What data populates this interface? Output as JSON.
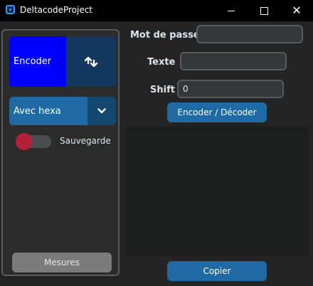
{
  "window": {
    "title": "DeltacodeProject",
    "minimize_icon": "minimize-icon",
    "maximize_icon": "maximize-icon",
    "close_glyph": "✕"
  },
  "sidebar": {
    "mode_label": "Encoder",
    "mode_icon": "swap-arrows-icon",
    "hexa_option": "Avec hexa",
    "dropdown_icon": "chevron-down-icon",
    "switch_label": "Sauvegarde",
    "switch_on": false,
    "mesures_button": "Mesures"
  },
  "form": {
    "password_label": "Mot de passe",
    "password_value": "",
    "text_label": "Texte",
    "text_value": "",
    "shift_label": "Shift",
    "shift_value": "0",
    "encode_button": "Encoder / Décoder"
  },
  "output": {
    "text": "",
    "copy_button": "Copier"
  },
  "colors": {
    "background": "#242424",
    "accent": "#1f6aa5",
    "mode_active": "#0000ff",
    "switch_knob": "#b3223a"
  }
}
